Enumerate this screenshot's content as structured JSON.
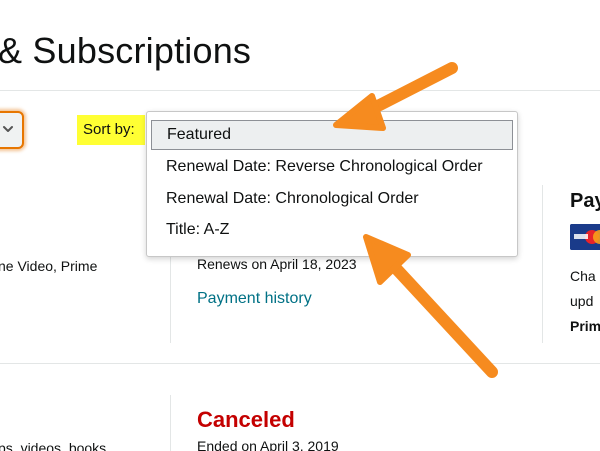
{
  "header": {
    "title": "& Subscriptions"
  },
  "sort": {
    "label": "Sort by:",
    "options": [
      "Featured",
      "Renewal Date: Reverse Chronological Order",
      "Renewal Date: Chronological Order",
      "Title: A-Z"
    ],
    "selected": "Featured"
  },
  "subscription_1": {
    "description_fragment": "ne Video, Prime",
    "renewal_text": "Renews on April 18, 2023",
    "payment_history_link": "Payment history"
  },
  "payment_panel": {
    "heading_fragment": "Pay",
    "line1_fragment": "Cha",
    "line2_fragment": "upd",
    "line3_fragment": "Prim"
  },
  "subscription_2": {
    "description_fragment": "ps, videos, books",
    "status": "Canceled",
    "ended_text": "Ended on April 3, 2019"
  },
  "colors": {
    "annotation_arrow": "#f68b1f",
    "highlight": "#ffff33",
    "canceled": "#c40000",
    "link": "#007185",
    "focus_ring": "#e77600"
  },
  "icons": {
    "filter_chevron": "chevron-down-icon",
    "card": "credit-card-icon",
    "annotation": "orange-arrow-icon"
  }
}
